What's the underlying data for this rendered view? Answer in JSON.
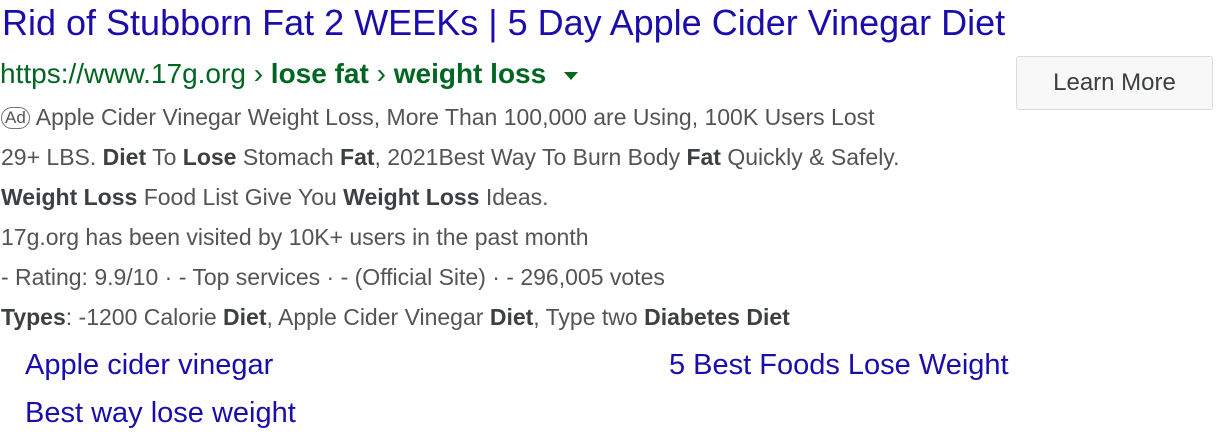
{
  "ad": {
    "title": "Rid of Stubborn Fat 2 WEEKs | 5 Day Apple Cider Vinegar Diet",
    "url": {
      "base": "https://www.17g.org",
      "separator": "›",
      "crumb1": "lose fat",
      "crumb2": "weight loss",
      "dropdown_icon": "caret-down-icon"
    },
    "cta_label": "Learn More",
    "badge": "Ad",
    "description": {
      "l1_text": "Apple Cider Vinegar Weight Loss, More Than 100,000 are Using, 100K Users Lost",
      "l2": [
        "29+ LBS. ",
        "Diet",
        " To ",
        "Lose",
        " Stomach ",
        "Fat",
        ", 2021Best Way To Burn Body ",
        "Fat",
        " Quickly & Safely."
      ],
      "l3": [
        "Weight Loss",
        " Food List Give You ",
        "Weight Loss",
        " Ideas."
      ],
      "l4": "17g.org has been visited by 10K+ users in the past month",
      "l5": "- Rating: 9.9/10 · - Top services · - (Official Site) · - 296,005 votes",
      "l6": [
        "Types",
        ": -1200 Calorie ",
        "Diet",
        ", Apple Cider Vinegar ",
        "Diet",
        ", Type two ",
        "Diabetes Diet"
      ]
    },
    "sitelinks": [
      "Apple cider vinegar",
      "5 Best Foods Lose Weight",
      "Best way lose weight"
    ],
    "colors": {
      "title_link": "#1a0dab",
      "url_green": "#006621",
      "snippet_gray": "#545454"
    }
  }
}
